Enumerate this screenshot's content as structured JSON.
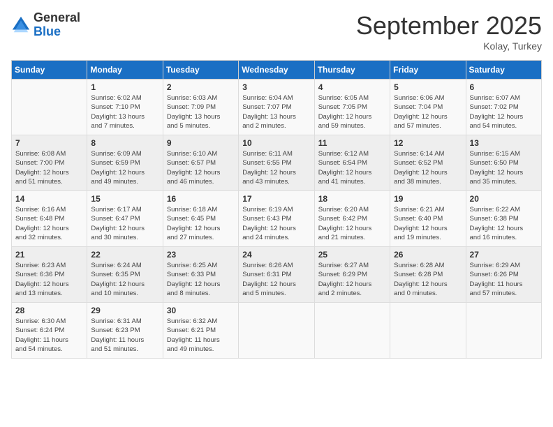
{
  "header": {
    "logo_general": "General",
    "logo_blue": "Blue",
    "month_title": "September 2025",
    "location": "Kolay, Turkey"
  },
  "weekdays": [
    "Sunday",
    "Monday",
    "Tuesday",
    "Wednesday",
    "Thursday",
    "Friday",
    "Saturday"
  ],
  "weeks": [
    [
      {
        "day": "",
        "info": ""
      },
      {
        "day": "1",
        "info": "Sunrise: 6:02 AM\nSunset: 7:10 PM\nDaylight: 13 hours\nand 7 minutes."
      },
      {
        "day": "2",
        "info": "Sunrise: 6:03 AM\nSunset: 7:09 PM\nDaylight: 13 hours\nand 5 minutes."
      },
      {
        "day": "3",
        "info": "Sunrise: 6:04 AM\nSunset: 7:07 PM\nDaylight: 13 hours\nand 2 minutes."
      },
      {
        "day": "4",
        "info": "Sunrise: 6:05 AM\nSunset: 7:05 PM\nDaylight: 12 hours\nand 59 minutes."
      },
      {
        "day": "5",
        "info": "Sunrise: 6:06 AM\nSunset: 7:04 PM\nDaylight: 12 hours\nand 57 minutes."
      },
      {
        "day": "6",
        "info": "Sunrise: 6:07 AM\nSunset: 7:02 PM\nDaylight: 12 hours\nand 54 minutes."
      }
    ],
    [
      {
        "day": "7",
        "info": "Sunrise: 6:08 AM\nSunset: 7:00 PM\nDaylight: 12 hours\nand 51 minutes."
      },
      {
        "day": "8",
        "info": "Sunrise: 6:09 AM\nSunset: 6:59 PM\nDaylight: 12 hours\nand 49 minutes."
      },
      {
        "day": "9",
        "info": "Sunrise: 6:10 AM\nSunset: 6:57 PM\nDaylight: 12 hours\nand 46 minutes."
      },
      {
        "day": "10",
        "info": "Sunrise: 6:11 AM\nSunset: 6:55 PM\nDaylight: 12 hours\nand 43 minutes."
      },
      {
        "day": "11",
        "info": "Sunrise: 6:12 AM\nSunset: 6:54 PM\nDaylight: 12 hours\nand 41 minutes."
      },
      {
        "day": "12",
        "info": "Sunrise: 6:14 AM\nSunset: 6:52 PM\nDaylight: 12 hours\nand 38 minutes."
      },
      {
        "day": "13",
        "info": "Sunrise: 6:15 AM\nSunset: 6:50 PM\nDaylight: 12 hours\nand 35 minutes."
      }
    ],
    [
      {
        "day": "14",
        "info": "Sunrise: 6:16 AM\nSunset: 6:48 PM\nDaylight: 12 hours\nand 32 minutes."
      },
      {
        "day": "15",
        "info": "Sunrise: 6:17 AM\nSunset: 6:47 PM\nDaylight: 12 hours\nand 30 minutes."
      },
      {
        "day": "16",
        "info": "Sunrise: 6:18 AM\nSunset: 6:45 PM\nDaylight: 12 hours\nand 27 minutes."
      },
      {
        "day": "17",
        "info": "Sunrise: 6:19 AM\nSunset: 6:43 PM\nDaylight: 12 hours\nand 24 minutes."
      },
      {
        "day": "18",
        "info": "Sunrise: 6:20 AM\nSunset: 6:42 PM\nDaylight: 12 hours\nand 21 minutes."
      },
      {
        "day": "19",
        "info": "Sunrise: 6:21 AM\nSunset: 6:40 PM\nDaylight: 12 hours\nand 19 minutes."
      },
      {
        "day": "20",
        "info": "Sunrise: 6:22 AM\nSunset: 6:38 PM\nDaylight: 12 hours\nand 16 minutes."
      }
    ],
    [
      {
        "day": "21",
        "info": "Sunrise: 6:23 AM\nSunset: 6:36 PM\nDaylight: 12 hours\nand 13 minutes."
      },
      {
        "day": "22",
        "info": "Sunrise: 6:24 AM\nSunset: 6:35 PM\nDaylight: 12 hours\nand 10 minutes."
      },
      {
        "day": "23",
        "info": "Sunrise: 6:25 AM\nSunset: 6:33 PM\nDaylight: 12 hours\nand 8 minutes."
      },
      {
        "day": "24",
        "info": "Sunrise: 6:26 AM\nSunset: 6:31 PM\nDaylight: 12 hours\nand 5 minutes."
      },
      {
        "day": "25",
        "info": "Sunrise: 6:27 AM\nSunset: 6:29 PM\nDaylight: 12 hours\nand 2 minutes."
      },
      {
        "day": "26",
        "info": "Sunrise: 6:28 AM\nSunset: 6:28 PM\nDaylight: 12 hours\nand 0 minutes."
      },
      {
        "day": "27",
        "info": "Sunrise: 6:29 AM\nSunset: 6:26 PM\nDaylight: 11 hours\nand 57 minutes."
      }
    ],
    [
      {
        "day": "28",
        "info": "Sunrise: 6:30 AM\nSunset: 6:24 PM\nDaylight: 11 hours\nand 54 minutes."
      },
      {
        "day": "29",
        "info": "Sunrise: 6:31 AM\nSunset: 6:23 PM\nDaylight: 11 hours\nand 51 minutes."
      },
      {
        "day": "30",
        "info": "Sunrise: 6:32 AM\nSunset: 6:21 PM\nDaylight: 11 hours\nand 49 minutes."
      },
      {
        "day": "",
        "info": ""
      },
      {
        "day": "",
        "info": ""
      },
      {
        "day": "",
        "info": ""
      },
      {
        "day": "",
        "info": ""
      }
    ]
  ]
}
